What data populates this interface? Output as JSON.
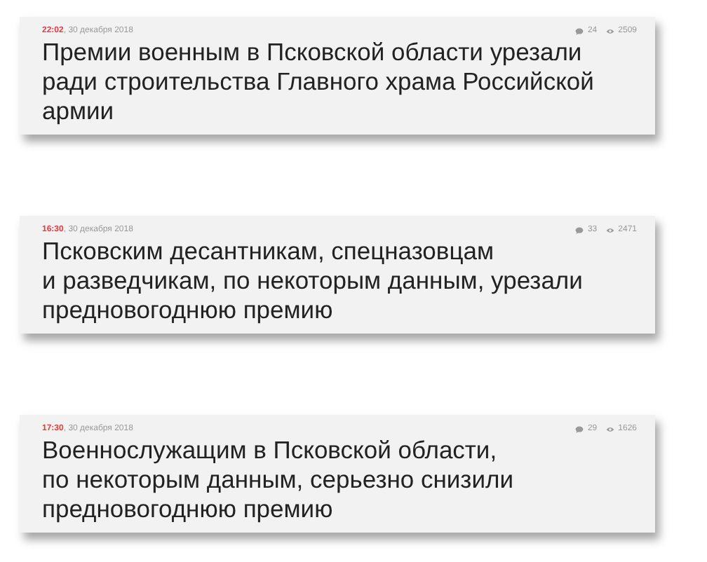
{
  "articles": [
    {
      "time": "22:02",
      "date": ", 30 декабря 2018",
      "comments": "24",
      "views": "2509",
      "headline": "Премии военным в Псковской области урезали\nради строительства Главного храма Российской\nармии"
    },
    {
      "time": "16:30",
      "date": ", 30 декабря 2018",
      "comments": "33",
      "views": "2471",
      "headline": "Псковским десантникам, спецназовцам\nи разведчикам, по некоторым данным, урезали\nпредновогоднюю премию"
    },
    {
      "time": "17:30",
      "date": ", 30 декабря 2018",
      "comments": "29",
      "views": "1626",
      "headline": "Военнослужащим в Псковской области,\nпо некоторым данным, серьезно снизили\nпредновогоднюю премию"
    }
  ]
}
